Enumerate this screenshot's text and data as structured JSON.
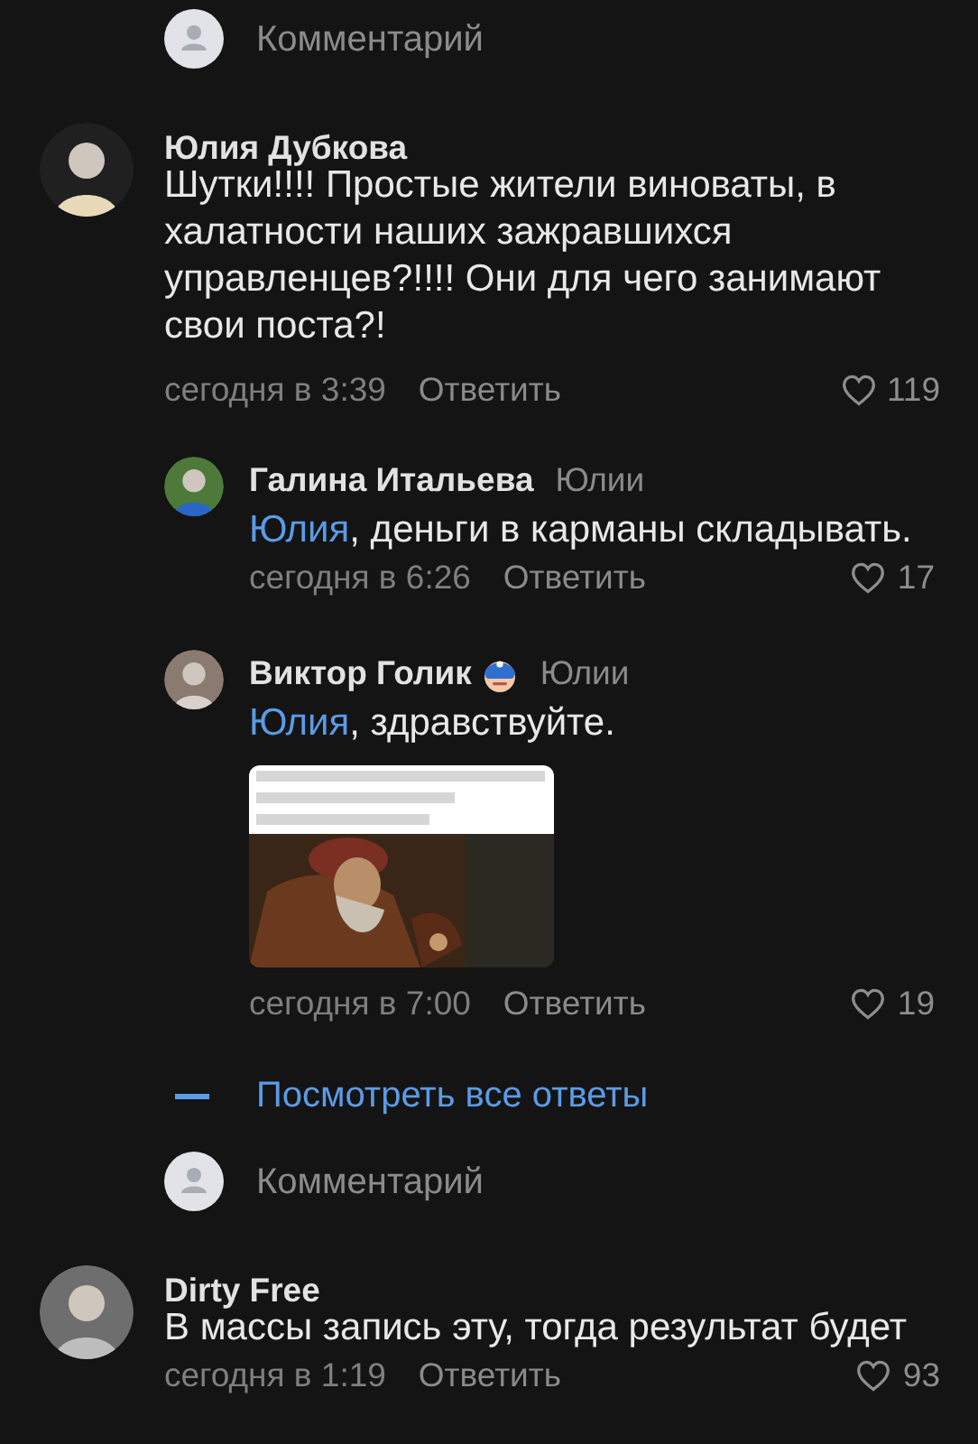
{
  "comment_field": {
    "placeholder": "Комментарий"
  },
  "comments": [
    {
      "author": "Юлия Дубкова",
      "text": "Шутки!!!! Простые жители виноваты, в халатности наших зажравшихся управленцев?!!!! Они для чего занимают свои поста?!",
      "time": "сегодня в 3:39",
      "reply": "Ответить",
      "likes": "119",
      "replies": [
        {
          "author": "Галина Итальева",
          "has_emoji": false,
          "reply_to": "Юлии",
          "mention": "Юлия",
          "text": ", деньги в карманы складывать.",
          "time": "сегодня в 6:26",
          "reply": "Ответить",
          "likes": "17"
        },
        {
          "author": "Виктор Голик",
          "has_emoji": true,
          "reply_to": "Юлии",
          "mention": "Юлия",
          "text": ", здравствуйте.",
          "time": "сегодня в 7:00",
          "reply": "Ответить",
          "likes": "19"
        }
      ],
      "show_all_replies": "Посмотреть все ответы",
      "reply_field": {
        "placeholder": "Комментарий"
      }
    },
    {
      "author": "Dirty Free",
      "text": "В массы запись эту, тогда результат будет",
      "time": "сегодня в 1:19",
      "reply": "Ответить",
      "likes": "93"
    }
  ]
}
